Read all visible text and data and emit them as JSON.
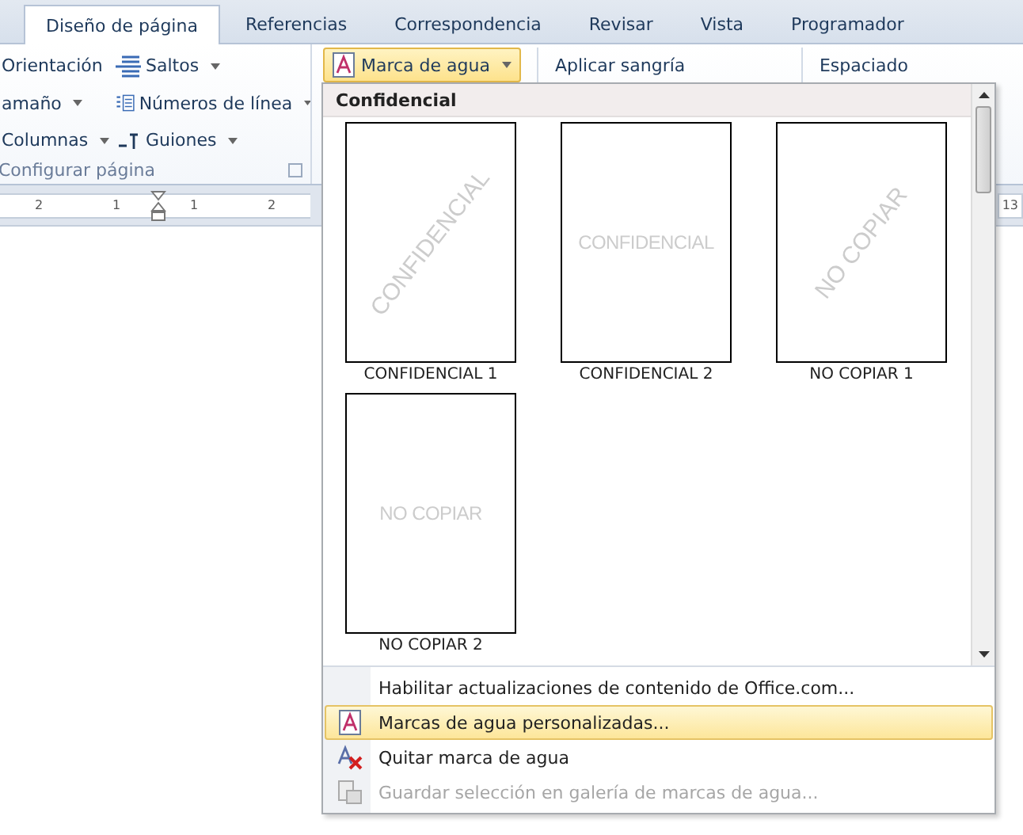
{
  "tabs": [
    {
      "label": "Diseño de página",
      "selected": true
    },
    {
      "label": "Referencias",
      "selected": false
    },
    {
      "label": "Correspondencia",
      "selected": false
    },
    {
      "label": "Revisar",
      "selected": false
    },
    {
      "label": "Vista",
      "selected": false
    },
    {
      "label": "Programador",
      "selected": false
    }
  ],
  "page_setup": {
    "items": [
      {
        "label": "Orientación",
        "kind": "plain"
      },
      {
        "label": "Saltos",
        "kind": "breaks"
      },
      {
        "label": "amaño",
        "kind": "plain"
      },
      {
        "label": "Números de línea",
        "kind": "lines"
      },
      {
        "label": "Columnas",
        "kind": "plain"
      },
      {
        "label": "Guiones",
        "kind": "hyphen"
      }
    ],
    "group_label": "Configurar página"
  },
  "watermark_button": {
    "label": "Marca de agua",
    "selected": true
  },
  "paragraph_headers": [
    "Aplicar sangría",
    "Espaciado"
  ],
  "ruler": {
    "labels": [
      "2",
      "1",
      "1",
      "2"
    ],
    "right_label": "13"
  },
  "watermark_menu": {
    "section": "Confidencial",
    "gallery": [
      {
        "watermark": "CONFIDENCIAL",
        "kind": "diagonal",
        "label": "CONFIDENCIAL 1"
      },
      {
        "watermark": "CONFIDENCIAL",
        "kind": "horizontal",
        "label": "CONFIDENCIAL 2"
      },
      {
        "watermark": "NO COPIAR",
        "kind": "diagonal",
        "label": "NO COPIAR 1"
      },
      {
        "watermark": "NO COPIAR",
        "kind": "horizontal",
        "label": "NO COPIAR 2"
      }
    ],
    "commands": [
      {
        "label": "Habilitar actualizaciones de contenido de Office.com...",
        "kind": "plain",
        "selected": false,
        "disabled": false
      },
      {
        "label": "Marcas de agua personalizadas...",
        "kind": "custom",
        "selected": true,
        "disabled": false
      },
      {
        "label": "Quitar marca de agua",
        "kind": "remove",
        "selected": false,
        "disabled": false
      },
      {
        "label": "Guardar selección en galería de marcas de agua...",
        "kind": "save",
        "selected": false,
        "disabled": true
      }
    ]
  }
}
